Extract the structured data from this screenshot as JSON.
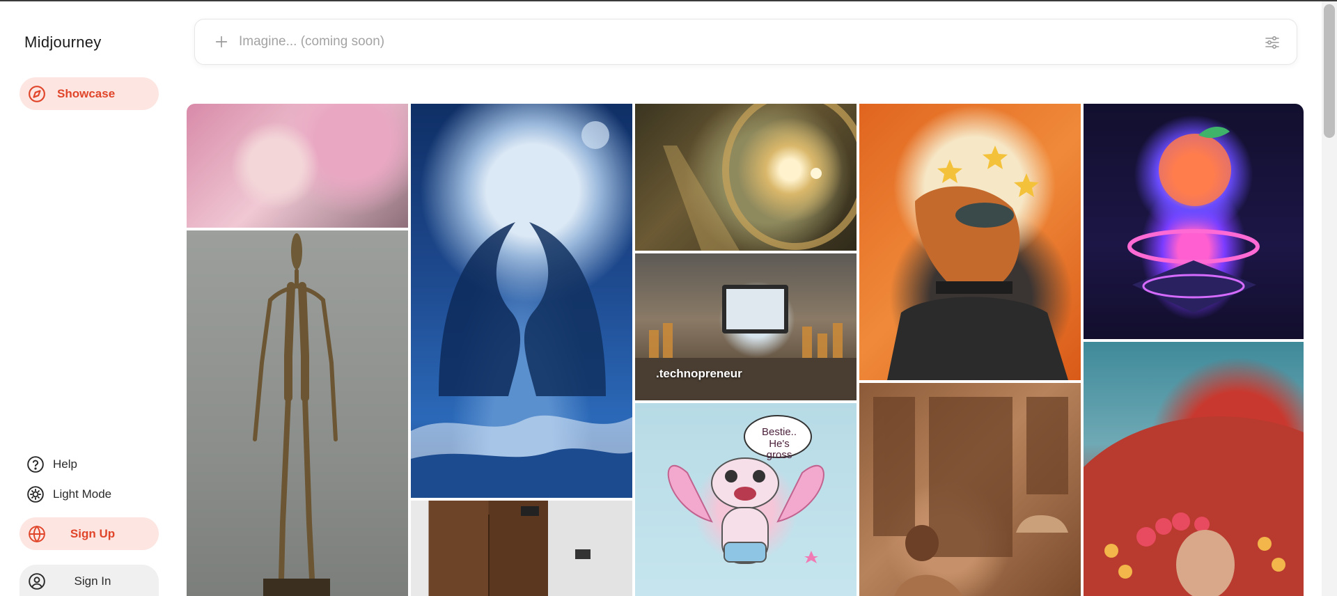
{
  "sidebar": {
    "brand": "Midjourney",
    "showcase_label": "Showcase",
    "help_label": "Help",
    "light_mode_label": "Light Mode",
    "sign_up_label": "Sign Up",
    "sign_in_label": "Sign In"
  },
  "search": {
    "placeholder": "Imagine... (coming soon)",
    "value": ""
  },
  "gallery": {
    "tiles": [
      {
        "caption": ""
      },
      {
        "caption": ""
      },
      {
        "caption": ""
      },
      {
        "caption": ""
      },
      {
        "caption": ""
      },
      {
        "caption": ".technopreneur"
      },
      {
        "caption": "Bestie.. He's gross"
      },
      {
        "caption": ""
      },
      {
        "caption": ""
      },
      {
        "caption": ""
      },
      {
        "caption": ""
      }
    ]
  },
  "icons": {
    "showcase": "compass-icon",
    "help": "question-circle-icon",
    "light_mode": "sun-icon",
    "sign_up": "globe-icon",
    "sign_in": "user-circle-icon",
    "search_plus": "plus-icon",
    "filter": "sliders-icon"
  },
  "colors": {
    "accent": "#e0452a",
    "accent_bg": "#fde5e1"
  }
}
